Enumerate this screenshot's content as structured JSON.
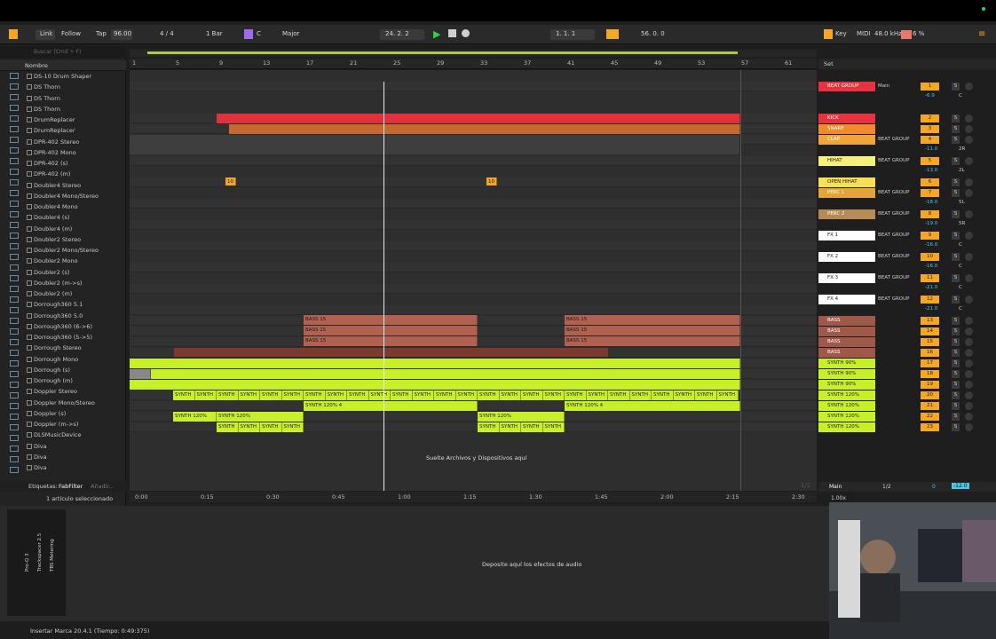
{
  "transport": {
    "link": "Link",
    "follow": "Follow",
    "tap": "Tap",
    "tempo": "96.00",
    "signature": "4 / 4",
    "quantize": "1 Bar",
    "key": "C",
    "scale": "Major",
    "position": "24.   2.   2",
    "loop_start": "1.   1.   1",
    "loop_length": "56.   0.   0",
    "key_label": "Key",
    "midi_label": "MIDI",
    "sample_rate": "48.0 kHz",
    "cpu": "6 %"
  },
  "browser": {
    "search_placeholder": "Buscar (Cmd + F)",
    "column_header": "Nombre",
    "items": [
      "DS-10 Drum Shaper",
      "DS Thorn",
      "DS Thorn",
      "DS Thorn",
      "DrumReplacer",
      "DrumReplacer",
      "DPR-402 Stereo",
      "DPR-402 Mono",
      "DPR-402 (s)",
      "DPR-402 (m)",
      "Doubler4 Stereo",
      "Doubler4 Mono/Stereo",
      "Doubler4 Mono",
      "Doubler4 (s)",
      "Doubler4 (m)",
      "Doubler2 Stereo",
      "Doubler2 Mono/Stereo",
      "Doubler2 Mono",
      "Doubler2 (s)",
      "Doubler2 (m->s)",
      "Doubler2 (m)",
      "Dorrough360 5.1",
      "Dorrough360 5.0",
      "Dorrough360 (6->6)",
      "Dorrough360 (5->5)",
      "Dorrough Stereo",
      "Dorrough Mono",
      "Dorrough (s)",
      "Dorrough (m)",
      "Doppler Stereo",
      "Doppler Mono/Stereo",
      "Doppler (s)",
      "Doppler (m->s)",
      "DLSMusicDevice",
      "Diva",
      "Diva",
      "Diva"
    ],
    "tags_label": "Etiquetas:",
    "tag": "FabFilter",
    "add_tag": "Añadir...",
    "selected": "1 artículo seleccionado"
  },
  "ruler": [
    "1",
    "5",
    "9",
    "13",
    "17",
    "21",
    "25",
    "29",
    "33",
    "37",
    "41",
    "45",
    "49",
    "53",
    "57",
    "61"
  ],
  "set_label": "Set",
  "timebar": [
    "0:00",
    "0:15",
    "0:30",
    "0:45",
    "1:00",
    "1:15",
    "1:30",
    "1:45",
    "2:00",
    "2:15",
    "2:30"
  ],
  "page_count": "1/1",
  "clips": {
    "bass": "BASS 15",
    "synth": "SYNTH",
    "synth120": "SYNTH 120%",
    "synth120_4": "SYNTH 120% 4",
    "marker": "10"
  },
  "drop_text": "Suelte Archivos y Dispositivos aquí",
  "tracks": [
    {
      "name": "BEAT GROUP",
      "num": "1",
      "color": "#e8333e",
      "out": "Main",
      "vol": "-6.9",
      "pan": "C"
    },
    {
      "name": "KICK",
      "num": "2",
      "color": "#e8333e",
      "out": "",
      "vol": "",
      "pan": ""
    },
    {
      "name": "SNARE",
      "num": "3",
      "color": "#f08a2c",
      "out": "",
      "vol": "",
      "pan": ""
    },
    {
      "name": "CLAP",
      "num": "4",
      "color": "#f0a43a",
      "out": "BEAT GROUP",
      "vol": "-11.0",
      "pan": "2R"
    },
    {
      "name": "HIHAT",
      "num": "5",
      "color": "#f6f07a",
      "out": "BEAT GROUP",
      "vol": "-13.0",
      "pan": "2L"
    },
    {
      "name": "OPEN HIHAT",
      "num": "6",
      "color": "#f6e054",
      "out": "",
      "vol": "",
      "pan": ""
    },
    {
      "name": "PERC 1",
      "num": "7",
      "color": "#e5a43a",
      "out": "BEAT GROUP",
      "vol": "-18.0",
      "pan": "5L"
    },
    {
      "name": "PERC 2",
      "num": "8",
      "color": "#b48a55",
      "out": "BEAT GROUP",
      "vol": "-19.0",
      "pan": "5R"
    },
    {
      "name": "FX 1",
      "num": "9",
      "color": "#ffffff",
      "out": "BEAT GROUP",
      "vol": "-16.0",
      "pan": "C"
    },
    {
      "name": "FX 2",
      "num": "10",
      "color": "#ffffff",
      "out": "BEAT GROUP",
      "vol": "-16.0",
      "pan": "C"
    },
    {
      "name": "FX 3",
      "num": "11",
      "color": "#ffffff",
      "out": "BEAT GROUP",
      "vol": "-21.0",
      "pan": "C"
    },
    {
      "name": "FX 4",
      "num": "12",
      "color": "#ffffff",
      "out": "BEAT GROUP",
      "vol": "-21.0",
      "pan": "C"
    },
    {
      "name": "BASS",
      "num": "13",
      "color": "#a0584a",
      "out": "",
      "vol": "",
      "pan": ""
    },
    {
      "name": "BASS",
      "num": "14",
      "color": "#a0584a",
      "out": "",
      "vol": "",
      "pan": ""
    },
    {
      "name": "BASS",
      "num": "15",
      "color": "#a0584a",
      "out": "",
      "vol": "",
      "pan": ""
    },
    {
      "name": "BASS",
      "num": "16",
      "color": "#a0584a",
      "out": "",
      "vol": "",
      "pan": ""
    },
    {
      "name": "SYNTH 90%",
      "num": "17",
      "color": "#c8f02a",
      "out": "",
      "vol": "",
      "pan": ""
    },
    {
      "name": "SYNTH 90%",
      "num": "18",
      "color": "#c8f02a",
      "out": "",
      "vol": "",
      "pan": ""
    },
    {
      "name": "SYNTH 90%",
      "num": "19",
      "color": "#c8f02a",
      "out": "",
      "vol": "",
      "pan": ""
    },
    {
      "name": "SYNTH 120%",
      "num": "20",
      "color": "#c8f02a",
      "out": "",
      "vol": "",
      "pan": ""
    },
    {
      "name": "SYNTH 120%",
      "num": "21",
      "color": "#c8f02a",
      "out": "",
      "vol": "",
      "pan": ""
    },
    {
      "name": "SYNTH 120%",
      "num": "22",
      "color": "#c8f02a",
      "out": "",
      "vol": "",
      "pan": ""
    },
    {
      "name": "SYNTH 120%",
      "num": "23",
      "color": "#c8f02a",
      "out": "",
      "vol": "",
      "pan": ""
    }
  ],
  "master": {
    "name": "Main",
    "sends": "1/2",
    "vol": "0",
    "level": "-12.0"
  },
  "zoom": "1.00x",
  "detail_drop": "Deposite aquí los efectos de audio",
  "device_names": [
    "Pro-Q 3",
    "Trackspacer 2.5",
    "TBS Metering"
  ],
  "status": "Insertar Marca 20.4.1 (Tiempo: 0:49:375)"
}
